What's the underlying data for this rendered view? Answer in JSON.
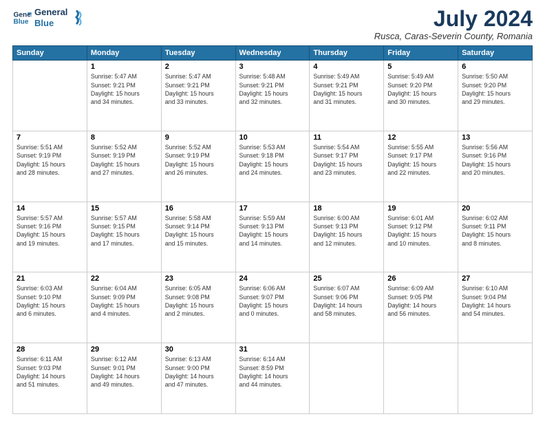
{
  "header": {
    "logo_line1": "General",
    "logo_line2": "Blue",
    "month": "July 2024",
    "location": "Rusca, Caras-Severin County, Romania"
  },
  "days_of_week": [
    "Sunday",
    "Monday",
    "Tuesday",
    "Wednesday",
    "Thursday",
    "Friday",
    "Saturday"
  ],
  "weeks": [
    [
      {
        "day": "",
        "info": ""
      },
      {
        "day": "1",
        "info": "Sunrise: 5:47 AM\nSunset: 9:21 PM\nDaylight: 15 hours\nand 34 minutes."
      },
      {
        "day": "2",
        "info": "Sunrise: 5:47 AM\nSunset: 9:21 PM\nDaylight: 15 hours\nand 33 minutes."
      },
      {
        "day": "3",
        "info": "Sunrise: 5:48 AM\nSunset: 9:21 PM\nDaylight: 15 hours\nand 32 minutes."
      },
      {
        "day": "4",
        "info": "Sunrise: 5:49 AM\nSunset: 9:21 PM\nDaylight: 15 hours\nand 31 minutes."
      },
      {
        "day": "5",
        "info": "Sunrise: 5:49 AM\nSunset: 9:20 PM\nDaylight: 15 hours\nand 30 minutes."
      },
      {
        "day": "6",
        "info": "Sunrise: 5:50 AM\nSunset: 9:20 PM\nDaylight: 15 hours\nand 29 minutes."
      }
    ],
    [
      {
        "day": "7",
        "info": "Sunrise: 5:51 AM\nSunset: 9:19 PM\nDaylight: 15 hours\nand 28 minutes."
      },
      {
        "day": "8",
        "info": "Sunrise: 5:52 AM\nSunset: 9:19 PM\nDaylight: 15 hours\nand 27 minutes."
      },
      {
        "day": "9",
        "info": "Sunrise: 5:52 AM\nSunset: 9:19 PM\nDaylight: 15 hours\nand 26 minutes."
      },
      {
        "day": "10",
        "info": "Sunrise: 5:53 AM\nSunset: 9:18 PM\nDaylight: 15 hours\nand 24 minutes."
      },
      {
        "day": "11",
        "info": "Sunrise: 5:54 AM\nSunset: 9:17 PM\nDaylight: 15 hours\nand 23 minutes."
      },
      {
        "day": "12",
        "info": "Sunrise: 5:55 AM\nSunset: 9:17 PM\nDaylight: 15 hours\nand 22 minutes."
      },
      {
        "day": "13",
        "info": "Sunrise: 5:56 AM\nSunset: 9:16 PM\nDaylight: 15 hours\nand 20 minutes."
      }
    ],
    [
      {
        "day": "14",
        "info": "Sunrise: 5:57 AM\nSunset: 9:16 PM\nDaylight: 15 hours\nand 19 minutes."
      },
      {
        "day": "15",
        "info": "Sunrise: 5:57 AM\nSunset: 9:15 PM\nDaylight: 15 hours\nand 17 minutes."
      },
      {
        "day": "16",
        "info": "Sunrise: 5:58 AM\nSunset: 9:14 PM\nDaylight: 15 hours\nand 15 minutes."
      },
      {
        "day": "17",
        "info": "Sunrise: 5:59 AM\nSunset: 9:13 PM\nDaylight: 15 hours\nand 14 minutes."
      },
      {
        "day": "18",
        "info": "Sunrise: 6:00 AM\nSunset: 9:13 PM\nDaylight: 15 hours\nand 12 minutes."
      },
      {
        "day": "19",
        "info": "Sunrise: 6:01 AM\nSunset: 9:12 PM\nDaylight: 15 hours\nand 10 minutes."
      },
      {
        "day": "20",
        "info": "Sunrise: 6:02 AM\nSunset: 9:11 PM\nDaylight: 15 hours\nand 8 minutes."
      }
    ],
    [
      {
        "day": "21",
        "info": "Sunrise: 6:03 AM\nSunset: 9:10 PM\nDaylight: 15 hours\nand 6 minutes."
      },
      {
        "day": "22",
        "info": "Sunrise: 6:04 AM\nSunset: 9:09 PM\nDaylight: 15 hours\nand 4 minutes."
      },
      {
        "day": "23",
        "info": "Sunrise: 6:05 AM\nSunset: 9:08 PM\nDaylight: 15 hours\nand 2 minutes."
      },
      {
        "day": "24",
        "info": "Sunrise: 6:06 AM\nSunset: 9:07 PM\nDaylight: 15 hours\nand 0 minutes."
      },
      {
        "day": "25",
        "info": "Sunrise: 6:07 AM\nSunset: 9:06 PM\nDaylight: 14 hours\nand 58 minutes."
      },
      {
        "day": "26",
        "info": "Sunrise: 6:09 AM\nSunset: 9:05 PM\nDaylight: 14 hours\nand 56 minutes."
      },
      {
        "day": "27",
        "info": "Sunrise: 6:10 AM\nSunset: 9:04 PM\nDaylight: 14 hours\nand 54 minutes."
      }
    ],
    [
      {
        "day": "28",
        "info": "Sunrise: 6:11 AM\nSunset: 9:03 PM\nDaylight: 14 hours\nand 51 minutes."
      },
      {
        "day": "29",
        "info": "Sunrise: 6:12 AM\nSunset: 9:01 PM\nDaylight: 14 hours\nand 49 minutes."
      },
      {
        "day": "30",
        "info": "Sunrise: 6:13 AM\nSunset: 9:00 PM\nDaylight: 14 hours\nand 47 minutes."
      },
      {
        "day": "31",
        "info": "Sunrise: 6:14 AM\nSunset: 8:59 PM\nDaylight: 14 hours\nand 44 minutes."
      },
      {
        "day": "",
        "info": ""
      },
      {
        "day": "",
        "info": ""
      },
      {
        "day": "",
        "info": ""
      }
    ]
  ]
}
